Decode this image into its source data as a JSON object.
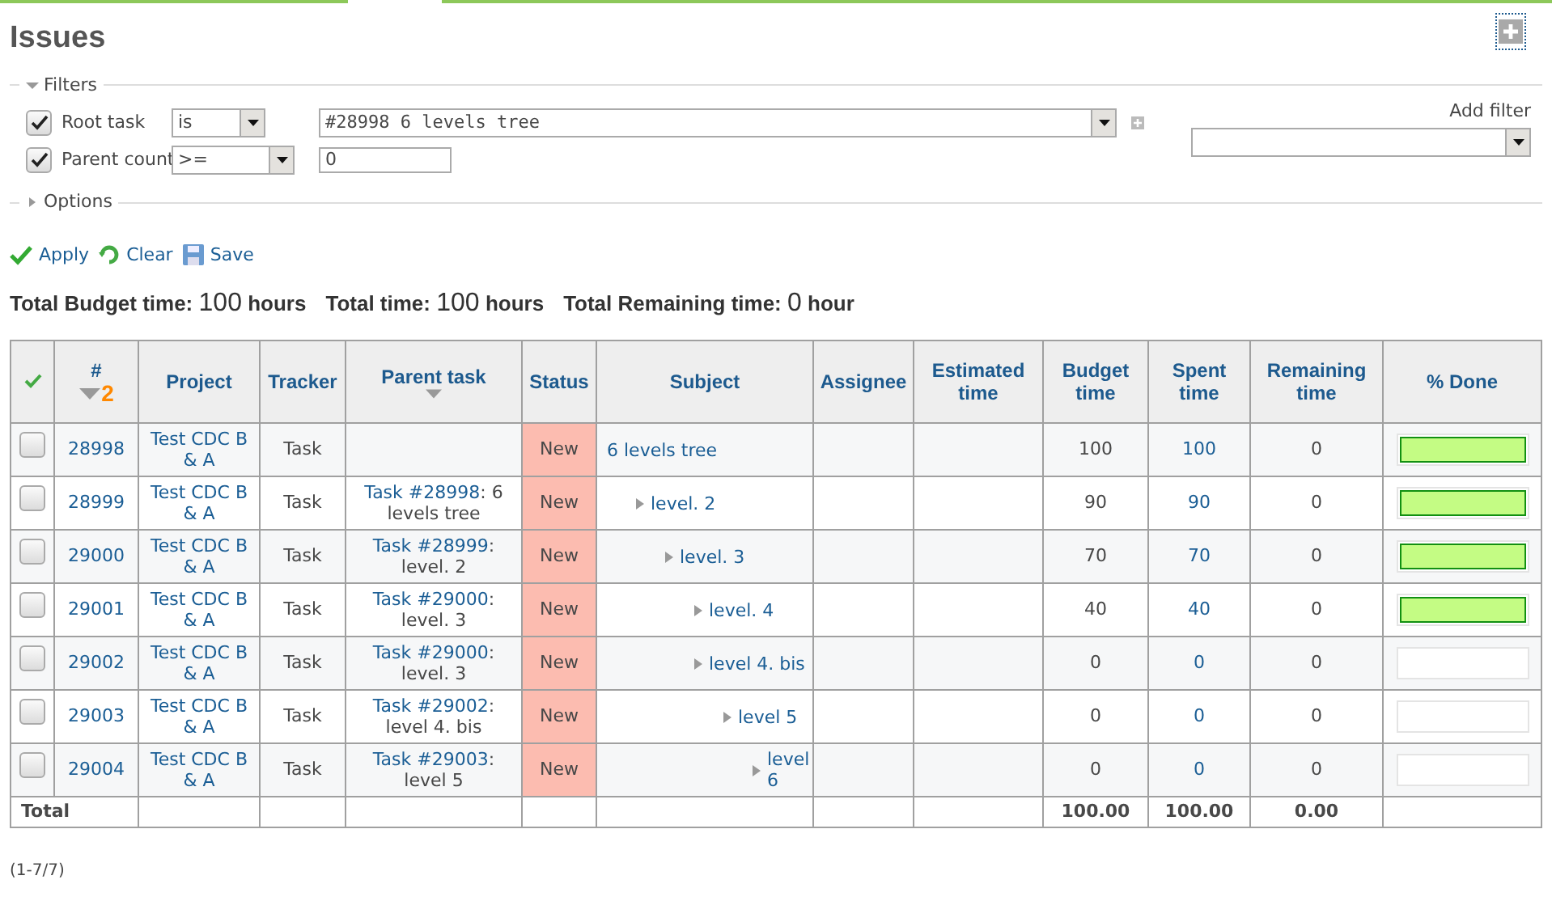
{
  "title": "Issues",
  "filters": {
    "legend": "Filters",
    "expanded": true,
    "rows": [
      {
        "label": "Root task",
        "checked": true,
        "operator": "is",
        "value": "#28998 6 levels tree",
        "kind": "select"
      },
      {
        "label": "Parent count",
        "checked": true,
        "operator": ">=",
        "value": "0",
        "kind": "text"
      }
    ],
    "add_filter": {
      "label": "Add filter"
    }
  },
  "options": {
    "legend": "Options",
    "expanded": false
  },
  "actions": [
    "Apply",
    "Clear",
    "Save"
  ],
  "totals": [
    {
      "label": "Total Budget time:",
      "value": "100",
      "unit": "hours"
    },
    {
      "label": "Total time:",
      "value": "100",
      "unit": "hours"
    },
    {
      "label": "Total Remaining time:",
      "value": "0",
      "unit": "hour"
    }
  ],
  "table": {
    "columns": [
      {
        "label": "#",
        "sort_caret": true,
        "sort_index": "2"
      },
      {
        "label": "Project"
      },
      {
        "label": "Tracker"
      },
      {
        "label": "Parent task",
        "sort_caret": true
      },
      {
        "label": "Status"
      },
      {
        "label": "Subject"
      },
      {
        "label": "Assignee"
      },
      {
        "label": "Estimated time"
      },
      {
        "label": "Budget time"
      },
      {
        "label": "Spent time"
      },
      {
        "label": "Remaining time"
      },
      {
        "label": "% Done"
      }
    ],
    "rows": [
      {
        "id": "28998",
        "project": "Test CDC B & A",
        "tracker": "Task",
        "status": "New",
        "subject": "6 levels tree",
        "budget": "100",
        "spent": "100",
        "remaining": "0",
        "level": 1,
        "checked": false,
        "children": [
          {
            "id": "28999",
            "project": "Test CDC B & A",
            "tracker": "Task",
            "parent_link": "Task #28998",
            "parent_rest": ": 6 levels tree",
            "status": "New",
            "subject": "level. 2",
            "budget": "90",
            "spent": "90",
            "remaining": "0",
            "level": 1,
            "checked": false,
            "children": [
              {
                "id": "29000",
                "project": "Test CDC B & A",
                "tracker": "Task",
                "parent_link": "Task #28999",
                "parent_rest": ": level. 2",
                "status": "New",
                "subject": "level. 3",
                "budget": "70",
                "spent": "70",
                "remaining": "0",
                "level": 1,
                "checked": false,
                "children": [
                  {
                    "id": "29001",
                    "project": "Test CDC B & A",
                    "tracker": "Task",
                    "parent_link": "Task #29000",
                    "parent_rest": ": level. 3",
                    "status": "New",
                    "subject": "level. 4",
                    "budget": "40",
                    "spent": "40",
                    "remaining": "0",
                    "level": 1,
                    "checked": false
                  },
                  {
                    "id": "29002",
                    "project": "Test CDC B & A",
                    "tracker": "Task",
                    "parent_link": "Task #29000",
                    "parent_rest": ": level. 3",
                    "status": "New",
                    "subject": "level 4. bis",
                    "budget": "0",
                    "spent": "0",
                    "remaining": "0",
                    "level": 0,
                    "checked": false,
                    "children": [
                      {
                        "id": "29003",
                        "project": "Test CDC B & A",
                        "tracker": "Task",
                        "parent_link": "Task #29002",
                        "parent_rest": ": level 4. bis",
                        "status": "New",
                        "subject": "level 5",
                        "budget": "0",
                        "spent": "0",
                        "remaining": "0",
                        "level": 0,
                        "checked": false,
                        "children": [
                          {
                            "id": "29004",
                            "project": "Test CDC B & A",
                            "tracker": "Task",
                            "parent_link": "Task #29003",
                            "parent_rest": ": level 5",
                            "status": "New",
                            "subject": "level 6",
                            "budget": "0",
                            "spent": "0",
                            "remaining": "0",
                            "level": 0,
                            "checked": false
                          }
                        ]
                      }
                    ]
                  }
                ]
              }
            ]
          }
        ]
      }
    ],
    "total": {
      "label": "Total",
      "budget": "100.00",
      "spent": "100.00",
      "remaining": "0.00"
    }
  },
  "pagination": "(1-7/7)"
}
